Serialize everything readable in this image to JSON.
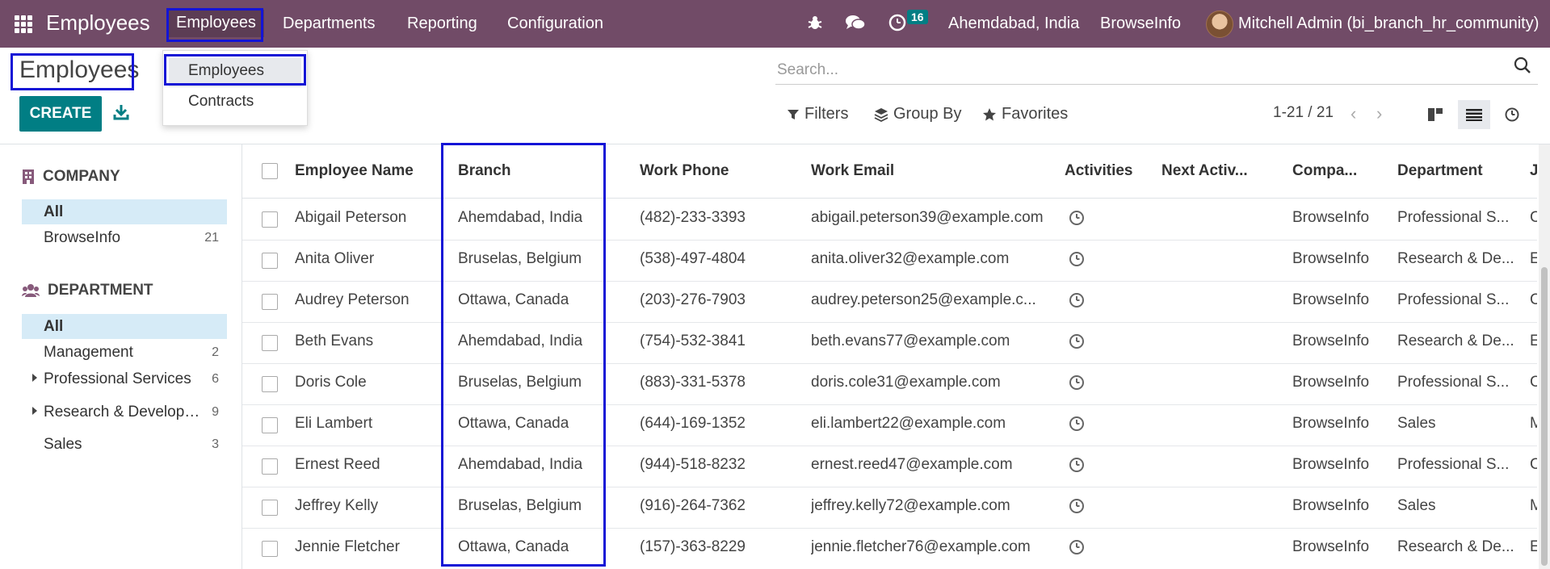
{
  "navbar": {
    "app_name": "Employees",
    "menu": [
      {
        "label": "Employees"
      },
      {
        "label": "Departments"
      },
      {
        "label": "Reporting"
      },
      {
        "label": "Configuration"
      }
    ],
    "activity_badge": "16",
    "branch": "Ahemdabad, India",
    "company": "BrowseInfo",
    "user": "Mitchell Admin (bi_branch_hr_community)"
  },
  "dropdown": {
    "items": [
      {
        "label": "Employees"
      },
      {
        "label": "Contracts"
      }
    ]
  },
  "control_panel": {
    "title": "Employees",
    "create_label": "CREATE",
    "search_placeholder": "Search...",
    "filters_label": "Filters",
    "group_by_label": "Group By",
    "favorites_label": "Favorites",
    "pager": "1-21 / 21"
  },
  "sidebar": {
    "company": {
      "heading": "COMPANY",
      "items": [
        {
          "label": "All",
          "count": ""
        },
        {
          "label": "BrowseInfo",
          "count": "21"
        }
      ]
    },
    "department": {
      "heading": "DEPARTMENT",
      "items": [
        {
          "label": "All",
          "count": ""
        },
        {
          "label": "Management",
          "count": "2"
        },
        {
          "label": "Professional Services",
          "count": "6"
        },
        {
          "label": "Research & Development",
          "count": "9"
        },
        {
          "label": "Sales",
          "count": "3"
        }
      ]
    }
  },
  "table": {
    "columns": [
      "Employee Name",
      "Branch",
      "Work Phone",
      "Work Email",
      "Activities",
      "Next Activ...",
      "Compa...",
      "Department",
      "J..."
    ],
    "rows": [
      {
        "name": "Abigail Peterson",
        "branch": "Ahemdabad, India",
        "phone": "(482)-233-3393",
        "email": "abigail.peterson39@example.com",
        "company": "BrowseInfo",
        "department": "Professional S...",
        "job": "C"
      },
      {
        "name": "Anita Oliver",
        "branch": "Bruselas, Belgium",
        "phone": "(538)-497-4804",
        "email": "anita.oliver32@example.com",
        "company": "BrowseInfo",
        "department": "Research & De...",
        "job": "E"
      },
      {
        "name": "Audrey Peterson",
        "branch": "Ottawa, Canada",
        "phone": "(203)-276-7903",
        "email": "audrey.peterson25@example.c...",
        "company": "BrowseInfo",
        "department": "Professional S...",
        "job": "C"
      },
      {
        "name": "Beth Evans",
        "branch": "Ahemdabad, India",
        "phone": "(754)-532-3841",
        "email": "beth.evans77@example.com",
        "company": "BrowseInfo",
        "department": "Research & De...",
        "job": "E"
      },
      {
        "name": "Doris Cole",
        "branch": "Bruselas, Belgium",
        "phone": "(883)-331-5378",
        "email": "doris.cole31@example.com",
        "company": "BrowseInfo",
        "department": "Professional S...",
        "job": "C"
      },
      {
        "name": "Eli Lambert",
        "branch": "Ottawa, Canada",
        "phone": "(644)-169-1352",
        "email": "eli.lambert22@example.com",
        "company": "BrowseInfo",
        "department": "Sales",
        "job": "M"
      },
      {
        "name": "Ernest Reed",
        "branch": "Ahemdabad, India",
        "phone": "(944)-518-8232",
        "email": "ernest.reed47@example.com",
        "company": "BrowseInfo",
        "department": "Professional S...",
        "job": "C"
      },
      {
        "name": "Jeffrey Kelly",
        "branch": "Bruselas, Belgium",
        "phone": "(916)-264-7362",
        "email": "jeffrey.kelly72@example.com",
        "company": "BrowseInfo",
        "department": "Sales",
        "job": "M"
      },
      {
        "name": "Jennie Fletcher",
        "branch": "Ottawa, Canada",
        "phone": "(157)-363-8229",
        "email": "jennie.fletcher76@example.com",
        "company": "BrowseInfo",
        "department": "Research & De...",
        "job": "E"
      }
    ]
  },
  "colors": {
    "navbar": "#714B67",
    "primary": "#017e84",
    "highlight_box": "#1414d6",
    "sidebar_selected": "#d6ebf7"
  },
  "icons": [
    "apps-grid-icon",
    "bug-icon",
    "chat-icon",
    "clock-icon",
    "download-icon",
    "search-icon",
    "filter-icon",
    "layers-icon",
    "star-icon",
    "kanban-view-icon",
    "list-view-icon",
    "activity-view-icon",
    "building-icon",
    "users-icon"
  ]
}
